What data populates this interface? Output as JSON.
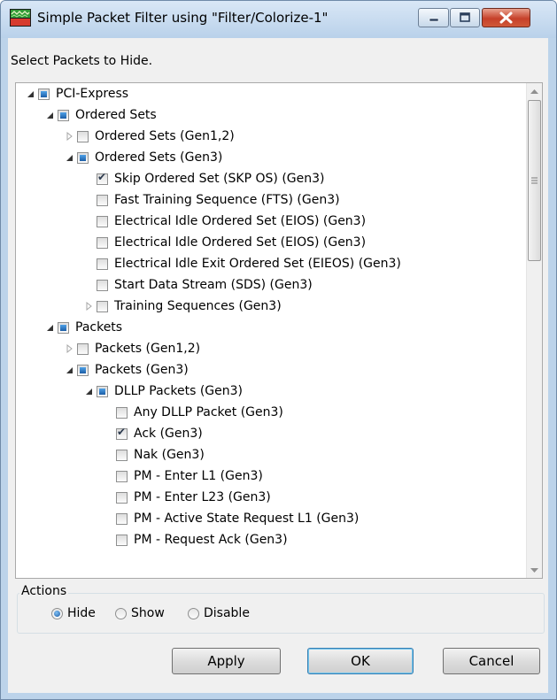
{
  "window": {
    "title": "Simple Packet Filter using \"Filter/Colorize-1\""
  },
  "prompt": "Select Packets to Hide.",
  "tree": [
    {
      "label": "PCI-Express",
      "state": "partial",
      "expander": "expanded",
      "level": 0
    },
    {
      "label": "Ordered Sets",
      "state": "partial",
      "expander": "expanded",
      "level": 1
    },
    {
      "label": "Ordered Sets (Gen1,2)",
      "state": "unchecked",
      "expander": "collapsed",
      "level": 2
    },
    {
      "label": "Ordered Sets (Gen3)",
      "state": "partial",
      "expander": "expanded",
      "level": 2
    },
    {
      "label": "Skip Ordered Set (SKP OS) (Gen3)",
      "state": "checked",
      "expander": "none",
      "level": 3
    },
    {
      "label": "Fast Training Sequence (FTS) (Gen3)",
      "state": "unchecked",
      "expander": "none",
      "level": 3
    },
    {
      "label": "Electrical Idle Ordered Set (EIOS) (Gen3)",
      "state": "unchecked",
      "expander": "none",
      "level": 3
    },
    {
      "label": "Electrical Idle Ordered Set (EIOS) (Gen3)",
      "state": "unchecked",
      "expander": "none",
      "level": 3
    },
    {
      "label": "Electrical Idle Exit Ordered Set (EIEOS) (Gen3)",
      "state": "unchecked",
      "expander": "none",
      "level": 3
    },
    {
      "label": "Start Data Stream (SDS) (Gen3)",
      "state": "unchecked",
      "expander": "none",
      "level": 3
    },
    {
      "label": "Training Sequences (Gen3)",
      "state": "unchecked",
      "expander": "collapsed",
      "level": 3
    },
    {
      "label": "Packets",
      "state": "partial",
      "expander": "expanded",
      "level": 1
    },
    {
      "label": "Packets (Gen1,2)",
      "state": "unchecked",
      "expander": "collapsed",
      "level": 2
    },
    {
      "label": "Packets (Gen3)",
      "state": "partial",
      "expander": "expanded",
      "level": 2
    },
    {
      "label": "DLLP Packets (Gen3)",
      "state": "partial",
      "expander": "expanded",
      "level": 3
    },
    {
      "label": "Any DLLP Packet (Gen3)",
      "state": "unchecked",
      "expander": "none",
      "level": 4
    },
    {
      "label": "Ack (Gen3)",
      "state": "checked",
      "expander": "none",
      "level": 4
    },
    {
      "label": "Nak (Gen3)",
      "state": "unchecked",
      "expander": "none",
      "level": 4
    },
    {
      "label": "PM - Enter L1 (Gen3)",
      "state": "unchecked",
      "expander": "none",
      "level": 4
    },
    {
      "label": "PM - Enter L23 (Gen3)",
      "state": "unchecked",
      "expander": "none",
      "level": 4
    },
    {
      "label": "PM - Active State Request L1 (Gen3)",
      "state": "unchecked",
      "expander": "none",
      "level": 4
    },
    {
      "label": "PM - Request Ack (Gen3)",
      "state": "unchecked",
      "expander": "none",
      "level": 4
    }
  ],
  "actions": {
    "legend": "Actions",
    "options": [
      {
        "label": "Hide",
        "selected": true
      },
      {
        "label": "Show",
        "selected": false
      },
      {
        "label": "Disable",
        "selected": false
      }
    ]
  },
  "buttons": {
    "apply": "Apply",
    "ok": "OK",
    "cancel": "Cancel"
  }
}
